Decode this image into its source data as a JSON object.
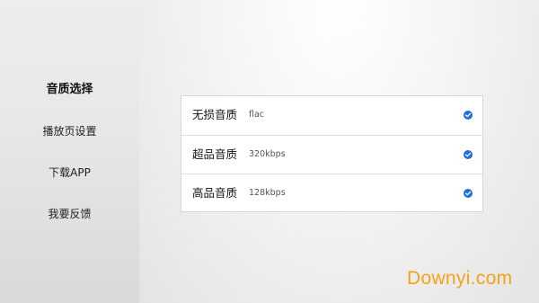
{
  "sidebar": {
    "items": [
      {
        "label": "音质选择",
        "active": true
      },
      {
        "label": "播放页设置",
        "active": false
      },
      {
        "label": "下载APP",
        "active": false
      },
      {
        "label": "我要反馈",
        "active": false
      }
    ]
  },
  "quality_options": [
    {
      "title": "无损音质",
      "subtitle": "flac",
      "checked": true
    },
    {
      "title": "超品音质",
      "subtitle": "320kbps",
      "checked": true
    },
    {
      "title": "高品音质",
      "subtitle": "128kbps",
      "checked": true
    }
  ],
  "colors": {
    "check_accent": "#1e6fd9",
    "watermark": "#f5a11a"
  },
  "icons": {
    "check": "check-circle-icon"
  },
  "watermark": "Downyi.com"
}
